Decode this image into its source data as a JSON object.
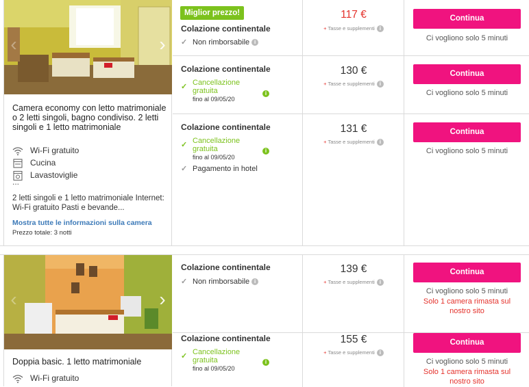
{
  "rooms": [
    {
      "title": "Camera economy con letto matrimoniale o 2 letti singoli, bagno condiviso. 2 letti singoli e 1 letto matrimoniale",
      "amenities": [
        {
          "icon": "wifi-icon",
          "label": "Wi-Fi gratuito"
        },
        {
          "icon": "kitchen-icon",
          "label": "Cucina"
        },
        {
          "icon": "dishwasher-icon",
          "label": "Lavastoviglie"
        }
      ],
      "more": "...",
      "description": "2 letti singoli e 1 letto matrimoniale Internet: Wi-Fi gratuito Pasti e bevande...",
      "show_info": "Mostra tutte le informazioni sulla camera",
      "total": "Prezzo totale: 3 notti",
      "options": [
        {
          "badge": "Miglior prezzo!",
          "meal": "Colazione continentale",
          "conditions": [
            {
              "text": "Non rimborsabile"
            }
          ],
          "price": "117 €",
          "taxes": "Tasse e supplementi",
          "button": "Continua",
          "note": "Ci vogliono solo 5 minuti"
        },
        {
          "meal": "Colazione continentale",
          "cancel_line1": "Cancellazione",
          "cancel_line2": "gratuita",
          "until": "fino al 09/05/20",
          "price": "130 €",
          "taxes": "Tasse e supplementi",
          "button": "Continua",
          "note": "Ci vogliono solo 5 minuti"
        },
        {
          "meal": "Colazione continentale",
          "cancel_line1": "Cancellazione",
          "cancel_line2": "gratuita",
          "until": "fino al 09/05/20",
          "extra": "Pagamento in hotel",
          "price": "131 €",
          "taxes": "Tasse e supplementi",
          "button": "Continua",
          "note": "Ci vogliono solo 5 minuti"
        }
      ]
    },
    {
      "title": "Doppia basic. 1 letto matrimoniale",
      "amenities": [
        {
          "icon": "wifi-icon",
          "label": "Wi-Fi gratuito"
        }
      ],
      "options": [
        {
          "meal": "Colazione continentale",
          "conditions": [
            {
              "text": "Non rimborsabile"
            }
          ],
          "price": "139 €",
          "taxes": "Tasse e supplementi",
          "button": "Continua",
          "note": "Ci vogliono solo 5 minuti",
          "warning_line1": "Solo 1 camera rimasta sul",
          "warning_line2": "nostro sito"
        },
        {
          "meal": "Colazione continentale",
          "cancel_line1": "Cancellazione",
          "cancel_line2": "gratuita",
          "until": "fino al 09/05/20",
          "price": "155 €",
          "taxes": "Tasse e supplementi",
          "button": "Continua",
          "note": "Ci vogliono solo 5 minuti",
          "warning_line1": "Solo 1 camera rimasta sul",
          "warning_line2": "nostro sito"
        }
      ]
    }
  ],
  "colors": {
    "accent_button": "#f0137f",
    "best_price_badge": "#7cc21d",
    "free_cancel": "#7cc21d",
    "price_red": "#e4312b",
    "link": "#3d7ab8"
  }
}
